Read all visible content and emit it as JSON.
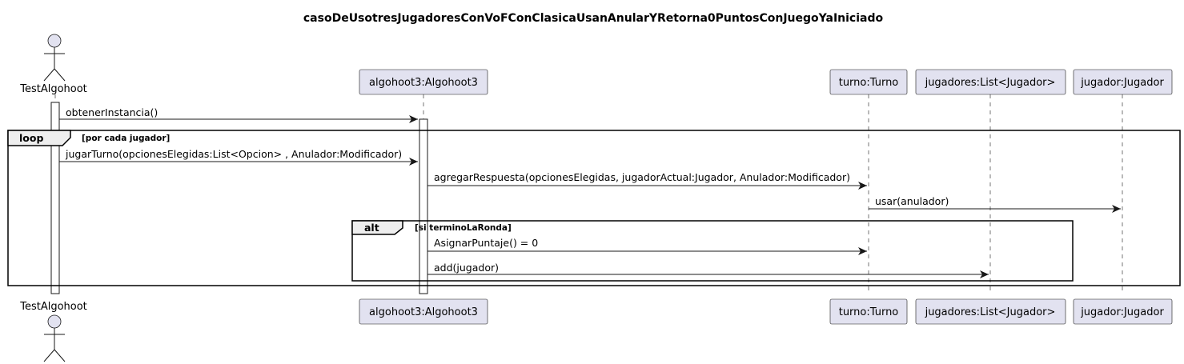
{
  "title": "casoDeUsotresJugadoresConVoFConClasicaUsanAnularYRetorna0PuntosConJuegoYaIniciado",
  "participants": [
    {
      "id": "test",
      "label": "TestAlgohoot",
      "kind": "actor"
    },
    {
      "id": "algo",
      "label": "algohoot3:Algohoot3",
      "kind": "participant"
    },
    {
      "id": "turno",
      "label": "turno:Turno",
      "kind": "participant"
    },
    {
      "id": "jugadores",
      "label": "jugadores:List<Jugador>",
      "kind": "participant"
    },
    {
      "id": "jugador",
      "label": "jugador:Jugador",
      "kind": "participant"
    }
  ],
  "messages": [
    {
      "from": "test",
      "to": "algo",
      "label": "obtenerInstancia()"
    },
    {
      "from": "test",
      "to": "algo",
      "label": "jugarTurno(opcionesElegidas:List<Opcion> , Anulador:Modificador)"
    },
    {
      "from": "algo",
      "to": "turno",
      "label": "agregarRespuesta(opcionesElegidas, jugadorActual:Jugador, Anulador:Modificador)"
    },
    {
      "from": "turno",
      "to": "jugador",
      "label": "usar(anulador)"
    },
    {
      "from": "algo",
      "to": "turno",
      "label": "AsignarPuntaje() = 0"
    },
    {
      "from": "algo",
      "to": "jugadores",
      "label": "add(jugador)"
    }
  ],
  "fragments": [
    {
      "kind": "loop",
      "condition": "[por cada jugador]"
    },
    {
      "kind": "alt",
      "condition": "[si terminoLaRonda]"
    }
  ],
  "colors": {
    "participant_fill": "#e2e2f0",
    "line": "#181818",
    "fragment_tab": "#eeeeee",
    "activation_fill": "#ffffff"
  }
}
